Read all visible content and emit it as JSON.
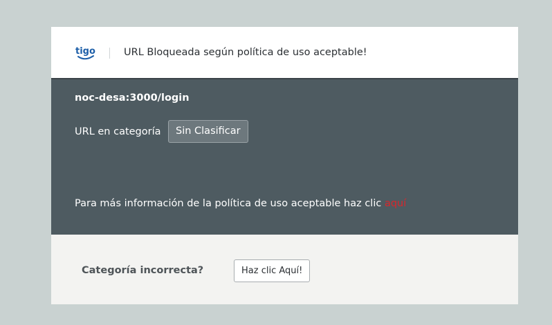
{
  "header": {
    "logo_text": "tigo",
    "title": "URL Bloqueada según política de uso aceptable!"
  },
  "blocked": {
    "url": "noc-desa:3000/login",
    "category_label": "URL en categoría",
    "category_value": "Sin Clasificar",
    "policy_text": "Para más información de la política de uso aceptable haz clic ",
    "policy_link": "aquí"
  },
  "footer": {
    "question": "Categoría incorrecta?",
    "button_label": "Haz clic Aquí!"
  },
  "colors": {
    "background": "#c9d2d1",
    "dark_panel": "#4e5b61",
    "footer_panel": "#f3f3f1",
    "brand_blue": "#1c5ea8",
    "link_red": "#d8272c"
  }
}
